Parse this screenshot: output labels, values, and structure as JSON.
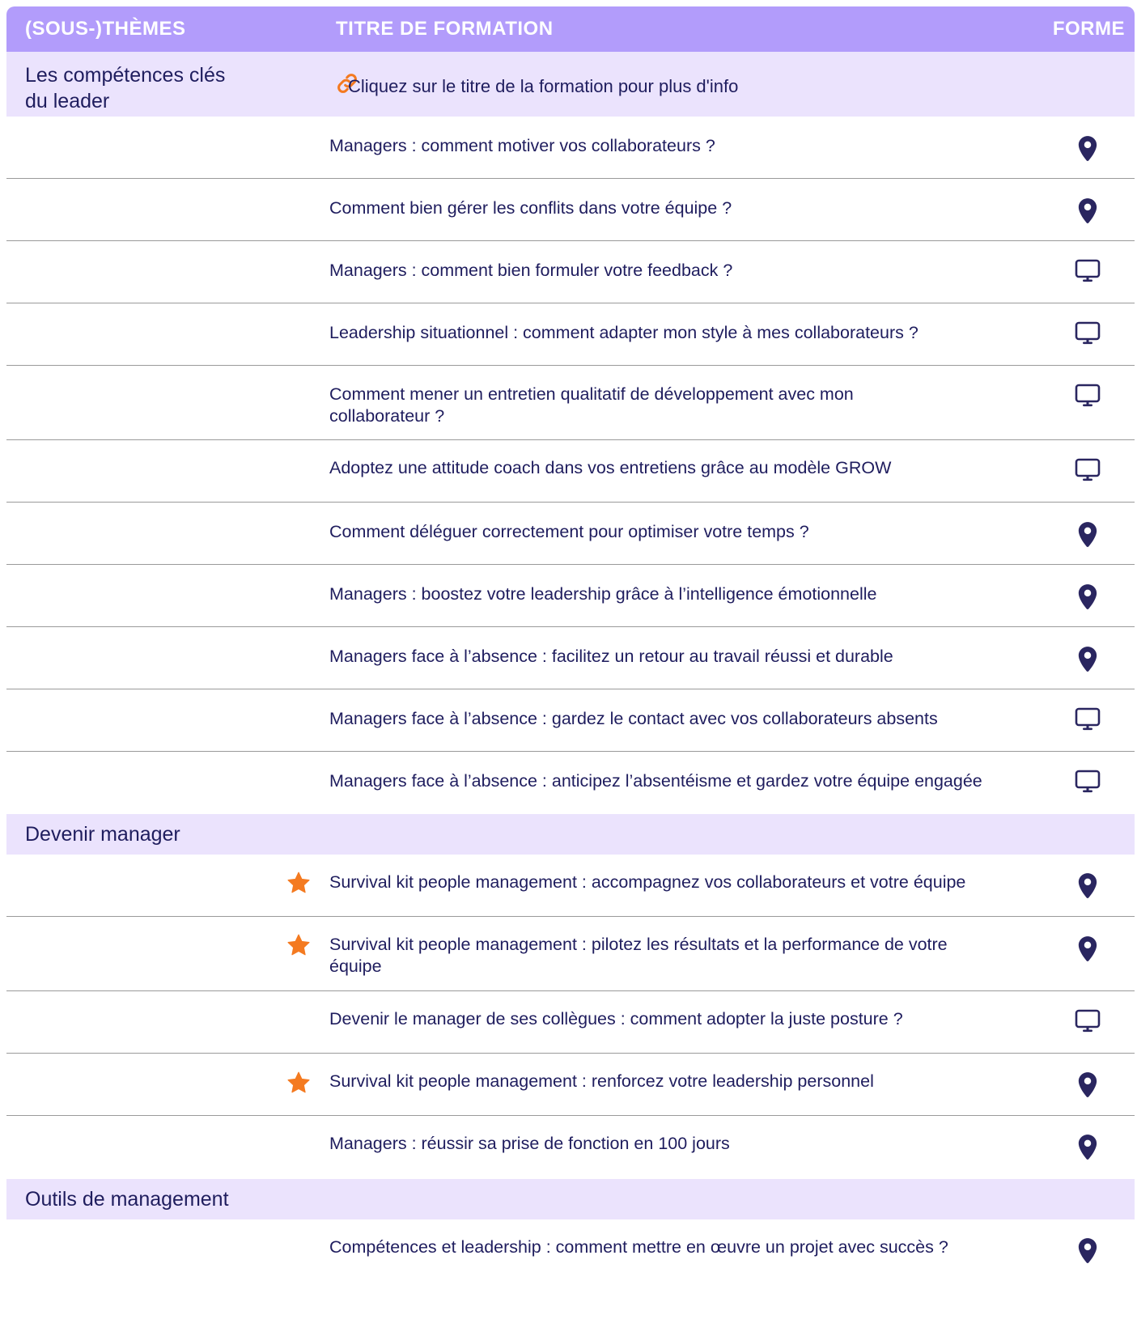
{
  "header": {
    "themes": "(SOUS-)THÈMES",
    "title": "TITRE DE FORMATION",
    "forme": "FORME"
  },
  "sections": [
    {
      "name": "Les compétences clés du leader",
      "name_line1": "Les compétences clés",
      "name_line2": "du leader",
      "hint": "Cliquez sur le titre de la formation pour plus d'info",
      "hint_icon": "link-icon",
      "rows": [
        {
          "title": "Managers : comment motiver vos collaborateurs ?",
          "forme": "location-pin-icon"
        },
        {
          "title": "Comment bien gérer les conflits dans votre équipe ?",
          "forme": "location-pin-icon"
        },
        {
          "title": "Managers : comment bien formuler votre feedback ?",
          "forme": "monitor-icon"
        },
        {
          "title": "Leadership situationnel : comment adapter mon style à mes collaborateurs ?",
          "forme": "monitor-icon"
        },
        {
          "title_line1": "Comment mener un entretien qualitatif de développement avec mon",
          "title_line2": "collaborateur ?",
          "forme": "monitor-icon"
        },
        {
          "title": "Adoptez une attitude coach dans vos entretiens grâce au modèle GROW",
          "forme": "monitor-icon"
        },
        {
          "title": "Comment déléguer correctement pour optimiser votre temps ?",
          "forme": "location-pin-icon"
        },
        {
          "title": "Managers : boostez votre leadership grâce à l’intelligence émotionnelle",
          "forme": "location-pin-icon"
        },
        {
          "title": "Managers face à l’absence : facilitez un retour au travail réussi et durable",
          "forme": "location-pin-icon"
        },
        {
          "title": "Managers face à l’absence : gardez le contact avec vos collaborateurs absents",
          "forme": "monitor-icon"
        },
        {
          "title": "Managers face à l’absence : anticipez l’absentéisme et gardez votre équipe engagée",
          "forme": "monitor-icon"
        }
      ]
    },
    {
      "name": "Devenir manager",
      "rows": [
        {
          "title": "Survival kit people management : accompagnez vos collaborateurs et votre équipe",
          "forme": "location-pin-icon",
          "starred": true
        },
        {
          "title_line1": "Survival kit people management : pilotez les résultats et la performance de votre",
          "title_line2": "équipe",
          "forme": "location-pin-icon",
          "starred": true
        },
        {
          "title": "Devenir le manager de ses collègues : comment adopter la juste posture ?",
          "forme": "monitor-icon"
        },
        {
          "title": "Survival kit people management : renforcez votre leadership personnel",
          "forme": "location-pin-icon",
          "starred": true
        },
        {
          "title": "Managers : réussir sa prise de fonction en 100 jours",
          "forme": "location-pin-icon"
        }
      ]
    },
    {
      "name": "Outils de management",
      "rows": [
        {
          "title": "Compétences et leadership : comment mettre en œuvre un projet avec succès ?",
          "forme": "location-pin-icon"
        }
      ]
    }
  ],
  "colors": {
    "header_bg": "#b29cfb",
    "section_bg": "#ebe3fd",
    "text": "#1f1d5e",
    "icon": "#2a2660",
    "star": "#f47a20",
    "link": "#f47a20"
  }
}
